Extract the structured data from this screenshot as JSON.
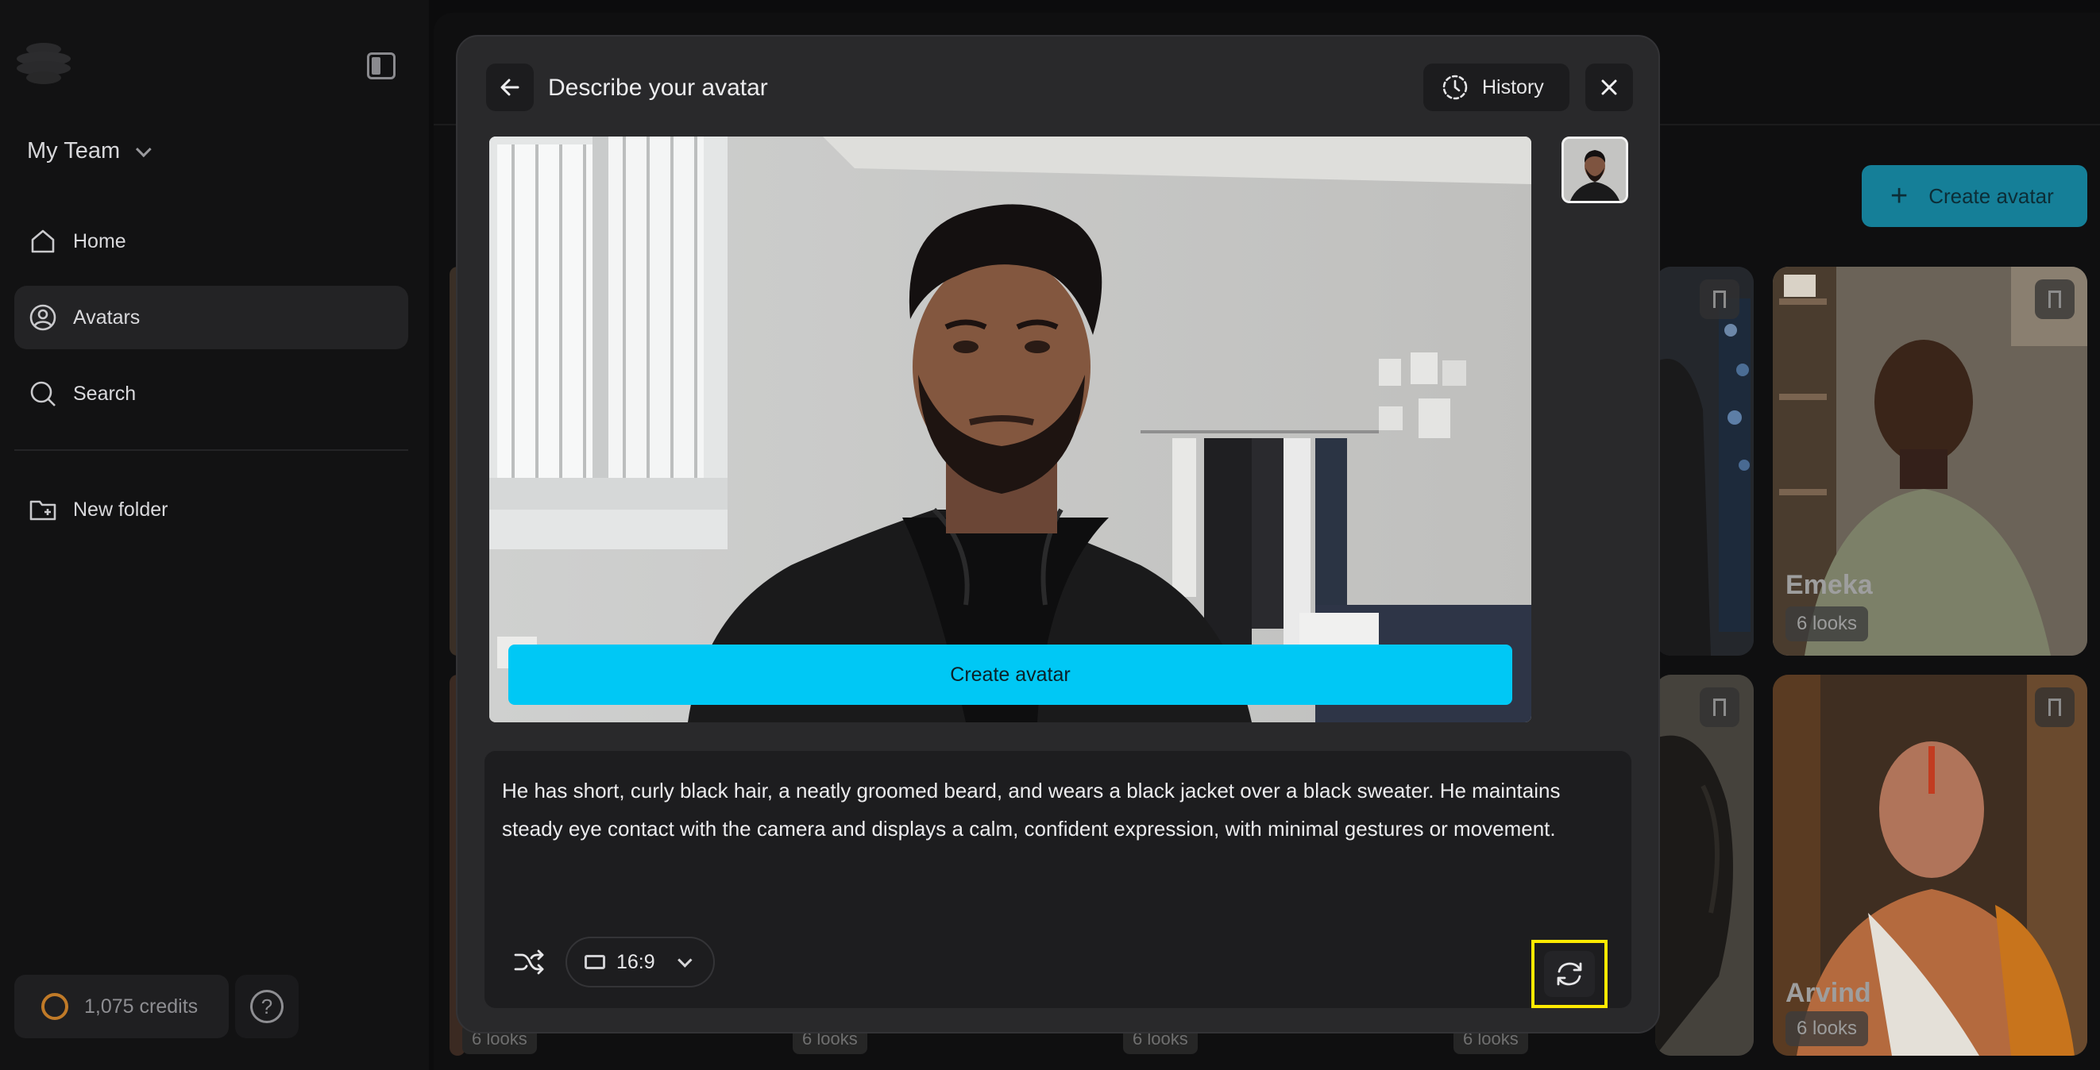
{
  "sidebar": {
    "team": "My Team",
    "nav": [
      {
        "label": "Home",
        "icon": "home-icon"
      },
      {
        "label": "Avatars",
        "icon": "user-circle-icon",
        "active": true
      },
      {
        "label": "Search",
        "icon": "search-icon"
      },
      {
        "label": "New folder",
        "icon": "folder-plus-icon"
      }
    ],
    "credits": "1,075 credits"
  },
  "main": {
    "create_avatar_label": "Create avatar",
    "cards": [
      {
        "name": "Emeka",
        "looks": "6 looks"
      },
      {
        "name": "Arvind",
        "looks": "6 looks"
      }
    ],
    "bottom_looks": [
      "6 looks",
      "6 looks",
      "6 looks",
      "6 looks"
    ]
  },
  "modal": {
    "title": "Describe your avatar",
    "history_label": "History",
    "create_button_label": "Create avatar",
    "description": "He has short, curly black hair, a neatly groomed beard, and wears a black jacket over a black sweater. He maintains steady eye contact with the camera and displays a calm, confident expression, with minimal gestures or movement.",
    "aspect_ratio": "16:9"
  },
  "colors": {
    "accent": "#00c8f5",
    "highlight": "#ffea00"
  }
}
